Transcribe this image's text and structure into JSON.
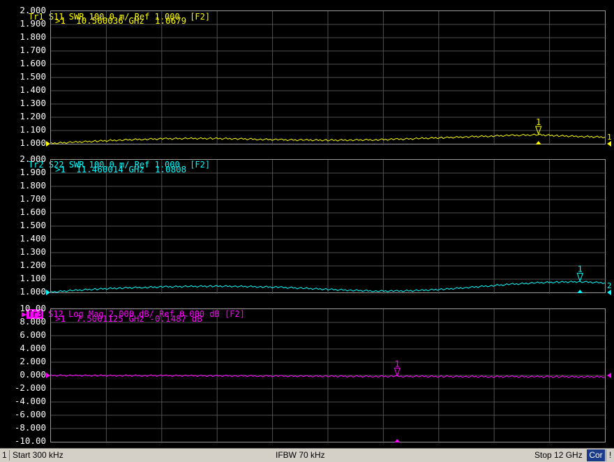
{
  "colors": {
    "tr1": "#ffff00",
    "tr2": "#00ffff",
    "tr3": "#ff00ff",
    "grid": "#505050",
    "frame": "#9a9a9a"
  },
  "traces": [
    {
      "header": {
        "id": "Tr1",
        "param": "S11",
        "format": "SWR",
        "scale": "100.0 m/",
        "ref": "Ref 1.000",
        "key": "[F2]"
      },
      "marker_readout": ">1  10.560036 GHz  1.0679",
      "marker_label": "1",
      "right_label": "1",
      "y_ticks": [
        "2.000",
        "1.900",
        "1.800",
        "1.700",
        "1.600",
        "1.500",
        "1.400",
        "1.300",
        "1.200",
        "1.100",
        "1.000"
      ]
    },
    {
      "header": {
        "id": "Tr2",
        "param": "S22",
        "format": "SWR",
        "scale": "100.0 m/",
        "ref": "Ref 1.000",
        "key": "[F2]"
      },
      "marker_readout": ">1  11.460014 GHz  1.0808",
      "marker_label": "1",
      "right_label": "2",
      "y_ticks": [
        "2.000",
        "1.900",
        "1.800",
        "1.700",
        "1.600",
        "1.500",
        "1.400",
        "1.300",
        "1.200",
        "1.100",
        "1.000"
      ]
    },
    {
      "header": {
        "id": "Tr3",
        "param": "S12",
        "format": "Log Mag",
        "scale": "2.000 dB/",
        "ref": "Ref 0.000 dB",
        "key": "[F2]"
      },
      "marker_readout": ">1  7.5001125 GHz -0.1487 dB",
      "marker_label": "1",
      "right_label": "",
      "y_ticks": [
        "10.00",
        "8.000",
        "6.000",
        "4.000",
        "2.000",
        "0.000",
        "-2.000",
        "-4.000",
        "-6.000",
        "-8.000",
        "-10.00"
      ]
    }
  ],
  "chart_data": [
    {
      "type": "line",
      "title": "Tr1 S11 SWR 100.0 m/ Ref 1.000 [F2]",
      "xlabel": "",
      "ylabel": "",
      "xlim": [
        0.0003,
        12
      ],
      "ylim": [
        1.0,
        2.0
      ],
      "grid": true,
      "series": [
        {
          "name": "S11",
          "x": [
            0.0003,
            0.5,
            1,
            1.5,
            2,
            2.5,
            3,
            3.5,
            4,
            4.5,
            5,
            5.5,
            6,
            6.5,
            7,
            7.5,
            8,
            8.5,
            9,
            9.5,
            10,
            10.56,
            11,
            11.5,
            12
          ],
          "y": [
            1.003,
            1.012,
            1.02,
            1.028,
            1.034,
            1.038,
            1.04,
            1.04,
            1.038,
            1.034,
            1.03,
            1.028,
            1.027,
            1.028,
            1.03,
            1.034,
            1.04,
            1.046,
            1.052,
            1.058,
            1.063,
            1.0679,
            1.06,
            1.055,
            1.05
          ]
        }
      ],
      "marker": {
        "x": 10.560036,
        "y": 1.0679
      }
    },
    {
      "type": "line",
      "title": "Tr2 S22 SWR 100.0 m/ Ref 1.000 [F2]",
      "xlabel": "",
      "ylabel": "",
      "xlim": [
        0.0003,
        12
      ],
      "ylim": [
        1.0,
        2.0
      ],
      "grid": true,
      "series": [
        {
          "name": "S22",
          "x": [
            0.0003,
            0.5,
            1,
            1.5,
            2,
            2.5,
            3,
            3.5,
            4,
            4.5,
            5,
            5.5,
            6,
            6.5,
            7,
            7.5,
            8,
            8.5,
            9,
            9.5,
            10,
            10.5,
            11,
            11.46,
            12
          ],
          "y": [
            1.003,
            1.015,
            1.025,
            1.033,
            1.038,
            1.042,
            1.045,
            1.047,
            1.046,
            1.043,
            1.038,
            1.031,
            1.023,
            1.016,
            1.011,
            1.01,
            1.015,
            1.024,
            1.036,
            1.05,
            1.062,
            1.072,
            1.078,
            1.0808,
            1.072
          ]
        }
      ],
      "marker": {
        "x": 11.460014,
        "y": 1.0808
      }
    },
    {
      "type": "line",
      "title": "Tr3 S12 Log Mag 2.000 dB/ Ref 0.000 dB [F2]",
      "xlabel": "",
      "ylabel": "",
      "xlim": [
        0.0003,
        12
      ],
      "ylim": [
        -10.0,
        10.0
      ],
      "grid": true,
      "series": [
        {
          "name": "S12",
          "x": [
            0.0003,
            0.5,
            1,
            1.5,
            2,
            2.5,
            3,
            3.5,
            4,
            4.5,
            5,
            5.5,
            6,
            6.5,
            7,
            7.5,
            8,
            8.5,
            9,
            9.5,
            10,
            10.5,
            11,
            11.5,
            12
          ],
          "y": [
            0.0,
            -0.01,
            -0.01,
            -0.02,
            -0.02,
            -0.03,
            -0.04,
            -0.05,
            -0.06,
            -0.08,
            -0.1,
            -0.11,
            -0.12,
            -0.13,
            -0.14,
            -0.1487,
            -0.15,
            -0.16,
            -0.17,
            -0.18,
            -0.18,
            -0.19,
            -0.19,
            -0.2,
            -0.2
          ]
        }
      ],
      "marker": {
        "x": 7.5001125,
        "y": -0.1487
      }
    }
  ],
  "status": {
    "channel": "1",
    "start": "Start 300 kHz",
    "ifbw": "IFBW 70 kHz",
    "stop": "Stop 12 GHz",
    "cor": "Cor",
    "warn": "!"
  }
}
